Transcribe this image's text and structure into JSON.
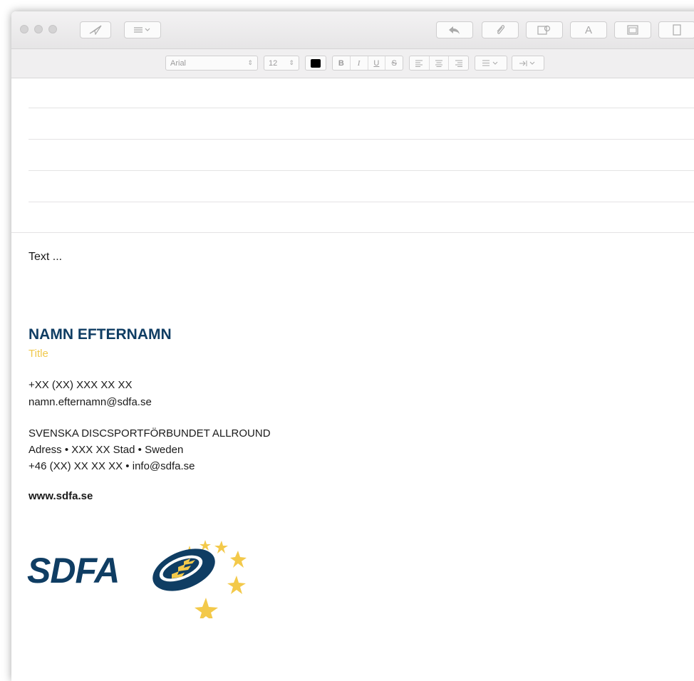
{
  "format": {
    "font_name": "Arial",
    "font_size": "12",
    "bold": "B",
    "italic": "I",
    "underline": "U",
    "strike": "S"
  },
  "toolbar": {
    "font_button": "A"
  },
  "message": {
    "body_text": "Text ..."
  },
  "signature": {
    "name": "NAMN EFTERNAMN",
    "title": "Title",
    "phone": "+XX (XX) XXX XX XX",
    "email": "namn.efternamn@sdfa.se",
    "org": "SVENSKA DISCSPORTFÖRBUNDET ALLROUND",
    "address": "Adress • XXX XX Stad • Sweden",
    "org_contact": "+46 (XX) XX XX XX • info@sdfa.se",
    "website": "www.sdfa.se",
    "logo_text": "SDFA"
  },
  "colors": {
    "brand_blue": "#0f3d63",
    "brand_yellow": "#f3c94a",
    "title_yellow": "#f0c84c"
  }
}
